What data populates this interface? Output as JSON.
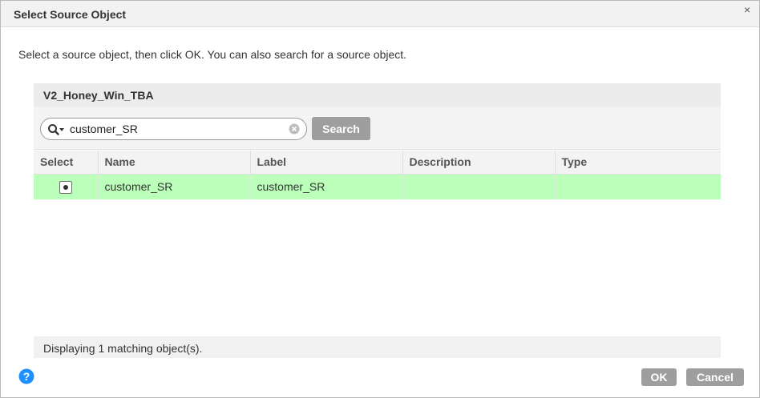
{
  "dialog": {
    "title": "Select Source Object",
    "close_symbol": "×",
    "instructions": "Select a source object, then click OK. You can also search for a source object."
  },
  "connection": {
    "name": "V2_Honey_Win_TBA"
  },
  "search": {
    "value": "customer_SR",
    "button_label": "Search",
    "icon": "search-dropdown-icon",
    "clear_icon": "clear-icon"
  },
  "table": {
    "columns": [
      "Select",
      "Name",
      "Label",
      "Description",
      "Type"
    ],
    "rows": [
      {
        "selected": true,
        "name": "customer_SR",
        "label": "customer_SR",
        "description": "",
        "type": ""
      }
    ],
    "selected_row_color": "#bbffbb"
  },
  "status": {
    "text": "Displaying 1 matching object(s)."
  },
  "footer": {
    "ok_label": "OK",
    "cancel_label": "Cancel",
    "help_icon": "help-icon",
    "help_color": "#1e90ff",
    "button_color": "#9e9e9e"
  }
}
